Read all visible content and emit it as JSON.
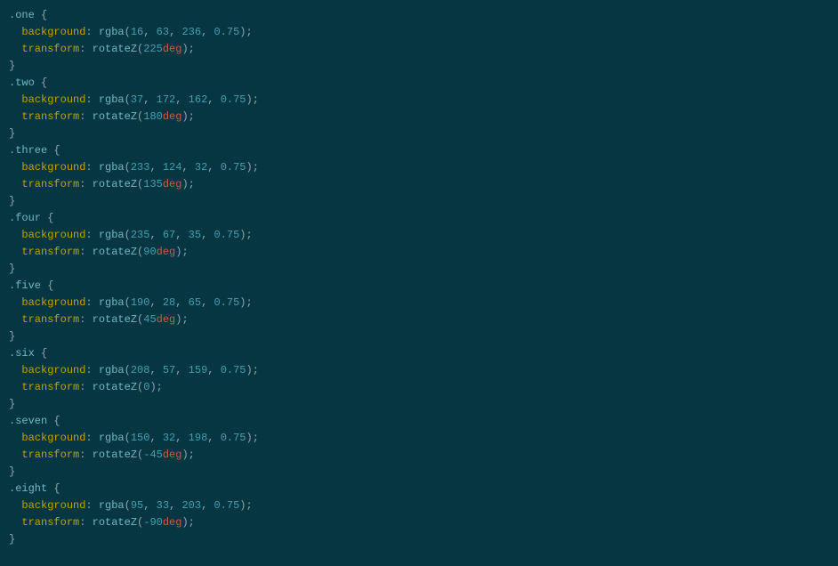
{
  "rules": [
    {
      "selector": ".one",
      "bg": [
        16,
        63,
        236,
        "0.75"
      ],
      "deg": "225"
    },
    {
      "selector": ".two",
      "bg": [
        37,
        172,
        162,
        "0.75"
      ],
      "deg": "180"
    },
    {
      "selector": ".three",
      "bg": [
        233,
        124,
        32,
        "0.75"
      ],
      "deg": "135"
    },
    {
      "selector": ".four",
      "bg": [
        235,
        67,
        35,
        "0.75"
      ],
      "deg": "90"
    },
    {
      "selector": ".five",
      "bg": [
        190,
        28,
        65,
        "0.75"
      ],
      "deg": "45"
    },
    {
      "selector": ".six",
      "bg": [
        208,
        57,
        159,
        "0.75"
      ],
      "deg": "0"
    },
    {
      "selector": ".seven",
      "bg": [
        150,
        32,
        198,
        "0.75"
      ],
      "deg": "-45"
    },
    {
      "selector": ".eight",
      "bg": [
        95,
        33,
        203,
        "0.75"
      ],
      "deg": "-90"
    }
  ],
  "tokens": {
    "background": "background",
    "transform": "transform",
    "rgba": "rgba",
    "rotateZ": "rotateZ",
    "deg": "deg"
  }
}
